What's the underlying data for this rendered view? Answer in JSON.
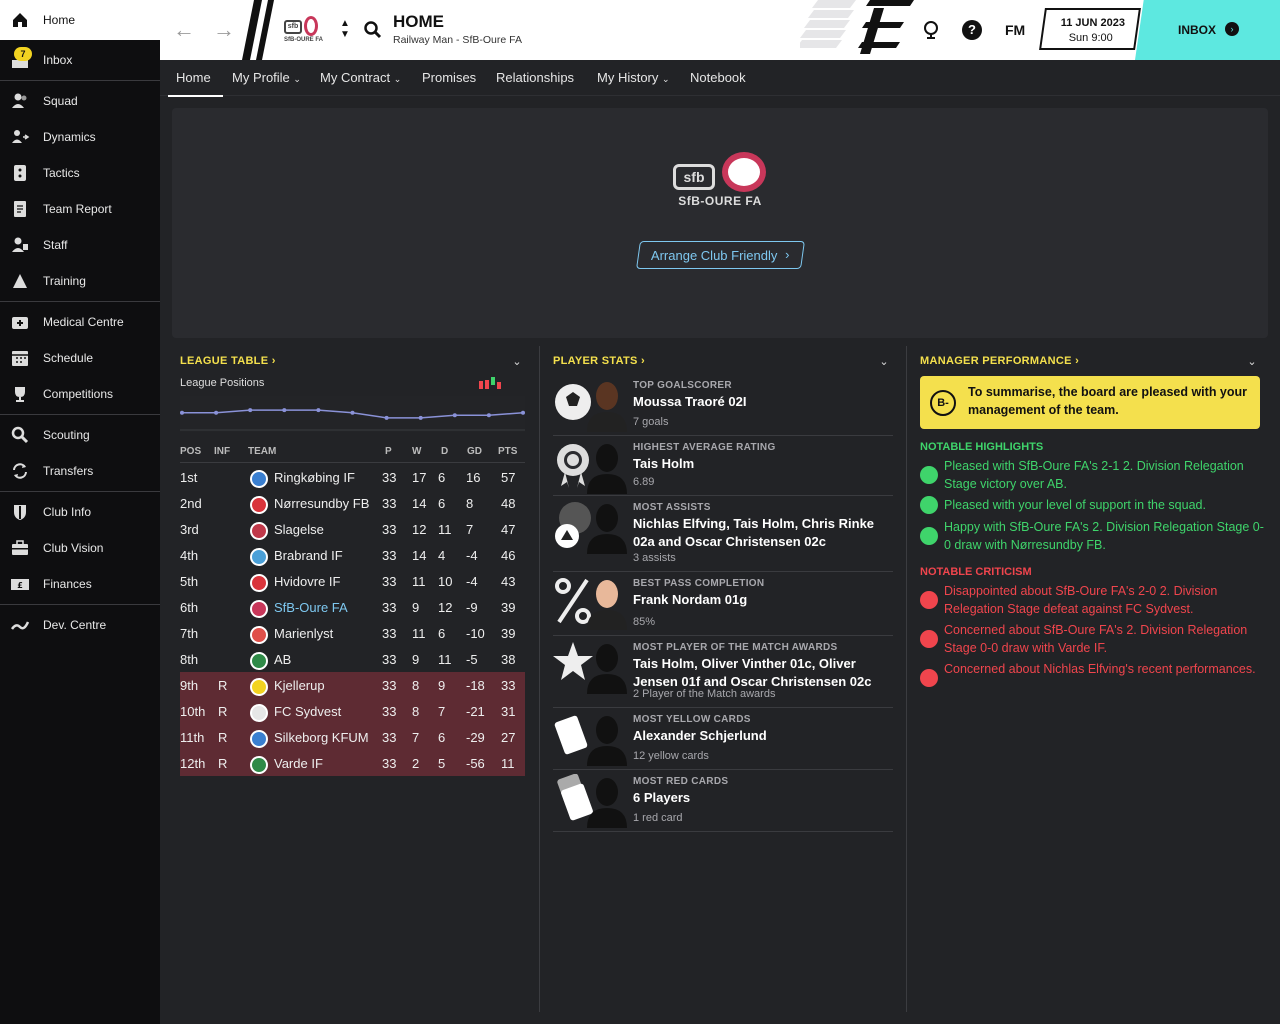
{
  "sidebar": {
    "items": [
      {
        "label": "Home",
        "icon": "home-icon"
      },
      {
        "label": "Inbox",
        "icon": "inbox-icon",
        "badge": "7"
      },
      {
        "label": "Squad",
        "icon": "squad-icon"
      },
      {
        "label": "Dynamics",
        "icon": "dynamics-icon"
      },
      {
        "label": "Tactics",
        "icon": "tactics-icon"
      },
      {
        "label": "Team Report",
        "icon": "report-icon"
      },
      {
        "label": "Staff",
        "icon": "staff-icon"
      },
      {
        "label": "Training",
        "icon": "training-icon"
      },
      {
        "label": "Medical Centre",
        "icon": "medical-icon"
      },
      {
        "label": "Schedule",
        "icon": "schedule-icon"
      },
      {
        "label": "Competitions",
        "icon": "trophy-icon"
      },
      {
        "label": "Scouting",
        "icon": "scouting-icon"
      },
      {
        "label": "Transfers",
        "icon": "transfers-icon"
      },
      {
        "label": "Club Info",
        "icon": "shield-icon"
      },
      {
        "label": "Club Vision",
        "icon": "vision-icon"
      },
      {
        "label": "Finances",
        "icon": "finances-icon"
      },
      {
        "label": "Dev. Centre",
        "icon": "dev-centre-icon"
      }
    ]
  },
  "header": {
    "title": "HOME",
    "subtitle": "Railway Man - SfB-Oure FA",
    "club_short": "SfB-OURE FA",
    "date": "11 JUN 2023",
    "day": "Sun 9:00",
    "inbox": "INBOX",
    "fm": "FM",
    "help": "?"
  },
  "tabs": [
    {
      "label": "Home"
    },
    {
      "label": "My Profile"
    },
    {
      "label": "My Contract"
    },
    {
      "label": "Promises"
    },
    {
      "label": "Relationships"
    },
    {
      "label": "My History"
    },
    {
      "label": "Notebook"
    }
  ],
  "hero": {
    "club_name": "SfB-OURE FA",
    "logo_text": "sfb",
    "button": "Arrange Club Friendly"
  },
  "league": {
    "title": "LEAGUE TABLE",
    "subtitle": "League Positions",
    "headers": {
      "pos": "POS",
      "inf": "INF",
      "team": "TEAM",
      "p": "P",
      "w": "W",
      "d": "D",
      "gd": "GD",
      "pts": "PTS"
    },
    "rows": [
      {
        "pos": "1st",
        "inf": "",
        "team": "Ringkøbing IF",
        "p": "33",
        "w": "17",
        "d": "6",
        "gd": "16",
        "pts": "57",
        "crest": "#3a7fd0"
      },
      {
        "pos": "2nd",
        "inf": "",
        "team": "Nørresundby FB",
        "p": "33",
        "w": "14",
        "d": "6",
        "gd": "8",
        "pts": "48",
        "crest": "#d9343b"
      },
      {
        "pos": "3rd",
        "inf": "",
        "team": "Slagelse",
        "p": "33",
        "w": "12",
        "d": "11",
        "gd": "7",
        "pts": "47",
        "crest": "#c0394a"
      },
      {
        "pos": "4th",
        "inf": "",
        "team": "Brabrand IF",
        "p": "33",
        "w": "14",
        "d": "4",
        "gd": "-4",
        "pts": "46",
        "crest": "#4aa0d8"
      },
      {
        "pos": "5th",
        "inf": "",
        "team": "Hvidovre IF",
        "p": "33",
        "w": "11",
        "d": "10",
        "gd": "-4",
        "pts": "43",
        "crest": "#d9343b"
      },
      {
        "pos": "6th",
        "inf": "",
        "team": "SfB-Oure FA",
        "p": "33",
        "w": "9",
        "d": "12",
        "gd": "-9",
        "pts": "39",
        "crest": "#c8375a",
        "own": true
      },
      {
        "pos": "7th",
        "inf": "",
        "team": "Marienlyst",
        "p": "33",
        "w": "11",
        "d": "6",
        "gd": "-10",
        "pts": "39",
        "crest": "#e0504a"
      },
      {
        "pos": "8th",
        "inf": "",
        "team": "AB",
        "p": "33",
        "w": "9",
        "d": "11",
        "gd": "-5",
        "pts": "38",
        "crest": "#2f8a48"
      },
      {
        "pos": "9th",
        "inf": "R",
        "team": "Kjellerup",
        "p": "33",
        "w": "8",
        "d": "9",
        "gd": "-18",
        "pts": "33",
        "crest": "#f2d321"
      },
      {
        "pos": "10th",
        "inf": "R",
        "team": "FC Sydvest",
        "p": "33",
        "w": "8",
        "d": "7",
        "gd": "-21",
        "pts": "31",
        "crest": "#e6e6e6"
      },
      {
        "pos": "11th",
        "inf": "R",
        "team": "Silkeborg KFUM",
        "p": "33",
        "w": "7",
        "d": "6",
        "gd": "-29",
        "pts": "27",
        "crest": "#3a7fd0"
      },
      {
        "pos": "12th",
        "inf": "R",
        "team": "Varde IF",
        "p": "33",
        "w": "2",
        "d": "5",
        "gd": "-56",
        "pts": "11",
        "crest": "#2f8a48"
      }
    ]
  },
  "player_stats": {
    "title": "PLAYER STATS",
    "items": [
      {
        "caption": "TOP GOALSCORER",
        "name": "Moussa Traoré 02I",
        "sub": "7 goals",
        "icon": "football-icon"
      },
      {
        "caption": "HIGHEST AVERAGE RATING",
        "name": "Tais Holm",
        "sub": "6.89",
        "icon": "rosette-icon"
      },
      {
        "caption": "MOST ASSISTS",
        "name": "Nichlas Elfving, Tais Holm, Chris Rinke 02a and Oscar Christensen 02c",
        "sub": "3 assists",
        "icon": "assist-icon"
      },
      {
        "caption": "BEST PASS COMPLETION",
        "name": "Frank Nordam 01g",
        "sub": "85%",
        "icon": "percent-icon"
      },
      {
        "caption": "MOST PLAYER OF THE MATCH AWARDS",
        "name": "Tais Holm, Oliver Vinther 01c, Oliver Jensen 01f and Oscar Christensen 02c",
        "sub": "2 Player of the Match awards",
        "icon": "star-icon"
      },
      {
        "caption": "MOST YELLOW CARDS",
        "name": "Alexander Schjerlund",
        "sub": "12 yellow cards",
        "icon": "yellow-card-icon"
      },
      {
        "caption": "MOST RED CARDS",
        "name": "6 Players",
        "sub": "1 red card",
        "icon": "red-card-icon"
      }
    ]
  },
  "manager": {
    "title": "MANAGER PERFORMANCE",
    "grade": "B-",
    "summary": "To summarise, the board are pleased with your management of the team.",
    "highlights_title": "NOTABLE HIGHLIGHTS",
    "highlights": [
      "Pleased with SfB-Oure FA's 2-1 2. Division Relegation Stage victory over AB.",
      "Pleased with your level of support in the squad.",
      "Happy with SfB-Oure FA's 2. Division Relegation Stage 0-0 draw with Nørresundby FB."
    ],
    "criticism_title": "NOTABLE CRITICISM",
    "criticism": [
      "Disappointed about SfB-Oure FA's 2-0 2. Division Relegation Stage defeat against FC Sydvest.",
      "Concerned about SfB-Oure FA's 2. Division Relegation Stage 0-0 draw with Varde IF.",
      "Concerned about Nichlas Elfving's recent performances."
    ]
  },
  "colors": {
    "accent": "#f4e04d",
    "inbox": "#5de8e0",
    "relegation": "#5e2b33",
    "positive": "#3fd46b",
    "negative": "#f0454d",
    "link": "#7ec8f0"
  },
  "chart_data": {
    "type": "line",
    "title": "League Positions",
    "series": [
      {
        "values": [
          6,
          6,
          5,
          5,
          5,
          6,
          8,
          8,
          7,
          7,
          6
        ]
      }
    ],
    "ylim": [
      1,
      12
    ],
    "grid": false
  }
}
